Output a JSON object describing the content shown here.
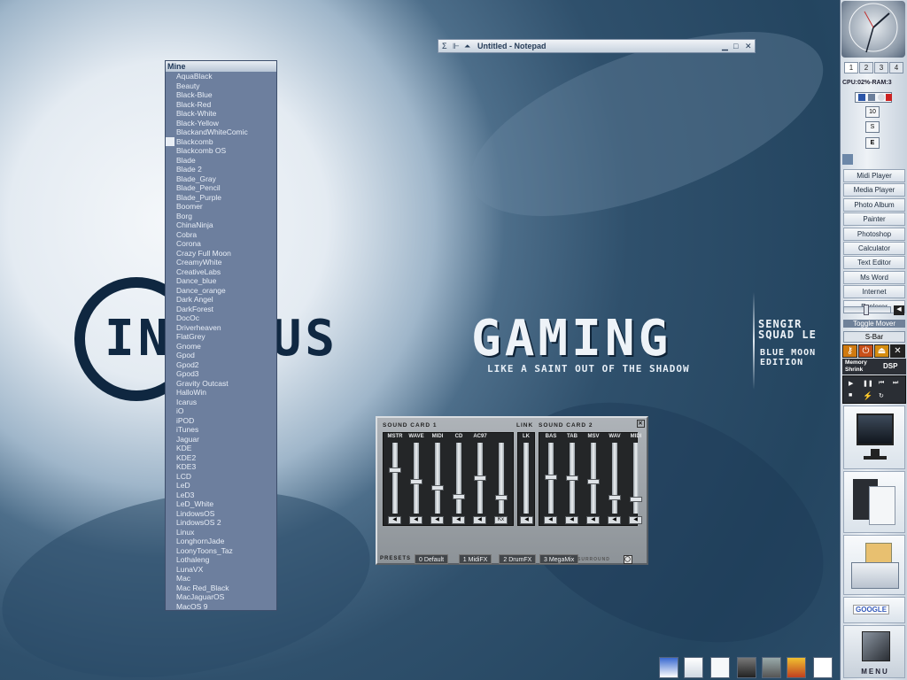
{
  "skin_menu": {
    "title": "Mine",
    "items": [
      "AquaBlack",
      "Beauty",
      "Black-Blue",
      "Black-Red",
      "Black-White",
      "Black-Yellow",
      "BlackandWhiteComic",
      "Blackcomb",
      "Blackcomb OS",
      "Blade",
      "Blade 2",
      "Blade_Gray",
      "Blade_Pencil",
      "Blade_Purple",
      "Boomer",
      "Borg",
      "ChinaNinja",
      "Cobra",
      "Corona",
      "Crazy Full Moon",
      "CreamyWhite",
      "CreativeLabs",
      "Dance_blue",
      "Dance_orange",
      "Dark Angel",
      "DarkForest",
      "DocOc",
      "Driverheaven",
      "FlatGrey",
      "Gnome",
      "Gpod",
      "Gpod2",
      "Gpod3",
      "Gravity Outcast",
      "HalloWin",
      "Icarus",
      "iO",
      "iPOD",
      "iTunes",
      "Jaguar",
      "KDE",
      "KDE2",
      "KDE3",
      "LCD",
      "LeD",
      "LeD3",
      "LeD_White",
      "LindowsOS",
      "LindowsOS 2",
      "Linux",
      "LonghornJade",
      "LoonyToons_Taz",
      "Lothaleng",
      "LunaVX",
      "Mac",
      "Mac Red_Black",
      "MacJaguarOS",
      "MacOS 9"
    ],
    "marked_index": 7
  },
  "notepad": {
    "title": "Untitled - Notepad"
  },
  "wallpaper": {
    "brand_left": "IN   IOUS",
    "brand_right": "GAMING",
    "tagline": "LIKE A SAINT OUT OF THE SHADOW",
    "sengir": [
      "SENGIR",
      "SQUAD LE"
    ],
    "edition": [
      "BLUE MOON",
      "EDITION"
    ]
  },
  "mixer": {
    "card1_label": "SOUND CARD 1",
    "link_label": "LINK",
    "card2_label": "SOUND CARD 2",
    "card1_channels": [
      {
        "name": "MSTR",
        "level": 0.62
      },
      {
        "name": "WAVE",
        "level": 0.45
      },
      {
        "name": "MIDI",
        "level": 0.35
      },
      {
        "name": "CD",
        "level": 0.22
      },
      {
        "name": "AC97",
        "level": 0.5
      },
      {
        "name": "",
        "level": 0.2,
        "button": "Kx"
      }
    ],
    "link_button": "LK",
    "card2_channels": [
      {
        "name": "BAS",
        "level": 0.52
      },
      {
        "name": "TAB",
        "level": 0.5
      },
      {
        "name": "MSV",
        "level": 0.44
      },
      {
        "name": "WAV",
        "level": 0.2
      },
      {
        "name": "MIDI",
        "level": 0.18
      }
    ],
    "presets_label": "PRESETS",
    "presets": [
      "0 Default",
      "1 MidiFX",
      "2 DrumFX",
      "3 MegaMix"
    ],
    "surround_label": "SURROUND"
  },
  "sidebar": {
    "virtual_desktops": [
      "1",
      "2",
      "3",
      "4"
    ],
    "cpu_ram": "CPU:02%-RAM:3",
    "small_buttons": [
      "10",
      "S",
      "E"
    ],
    "launchers": [
      "Midi Player",
      "Media Player",
      "Photo Album",
      "Painter",
      "Photoshop",
      "Calculator",
      "Text Editor",
      "Ms Word",
      "Internet",
      "Explorer"
    ],
    "toggle_label": "Toggle Mover",
    "sbar_label": "S-Bar",
    "memory_label": "Memory Shrink",
    "dsp_label": "DSP",
    "menu_label": "MENU",
    "google_label": "GOOGLE"
  }
}
